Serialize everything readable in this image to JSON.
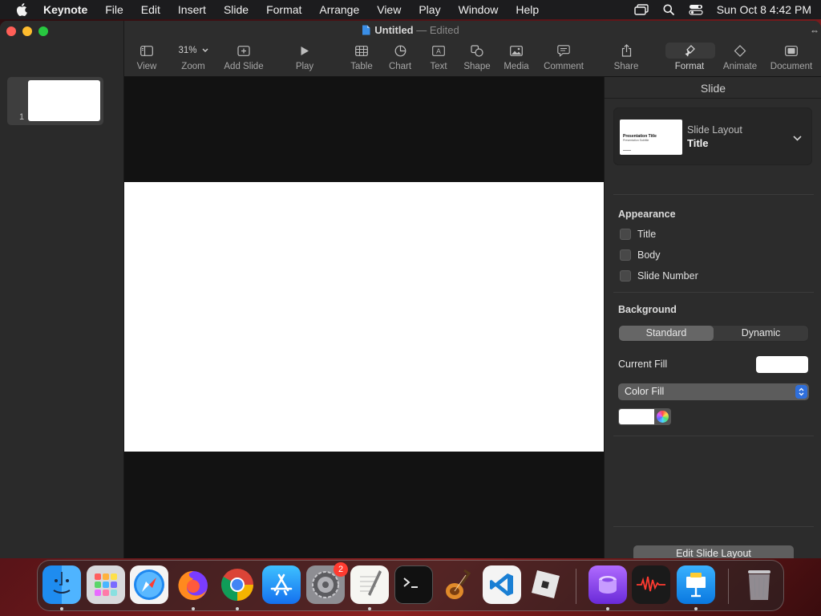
{
  "menubar": {
    "app_name": "Keynote",
    "items": [
      "File",
      "Edit",
      "Insert",
      "Slide",
      "Format",
      "Arrange",
      "View",
      "Play",
      "Window",
      "Help"
    ],
    "clock": "Sun Oct 8  4:42 PM"
  },
  "window": {
    "doc_name": "Untitled",
    "separator": "—",
    "doc_status": "Edited"
  },
  "toolbar": {
    "view": "View",
    "zoom_value": "31%",
    "zoom": "Zoom",
    "add_slide": "Add Slide",
    "play": "Play",
    "table": "Table",
    "chart": "Chart",
    "text": "Text",
    "shape": "Shape",
    "media": "Media",
    "comment": "Comment",
    "share": "Share",
    "format": "Format",
    "animate": "Animate",
    "document": "Document"
  },
  "navigator": {
    "slide_number": "1"
  },
  "inspector": {
    "title": "Slide",
    "layout_label": "Slide Layout",
    "layout_value": "Title",
    "layout_thumb_title": "Presentation Title",
    "layout_thumb_subtitle": "Presentation Subtitle",
    "appearance_heading": "Appearance",
    "appearance_options": [
      "Title",
      "Body",
      "Slide Number"
    ],
    "background_heading": "Background",
    "background_modes": [
      "Standard",
      "Dynamic"
    ],
    "current_fill_label": "Current Fill",
    "fill_type": "Color Fill",
    "edit_layout_button": "Edit Slide Layout"
  },
  "dock": {
    "settings_badge": "2"
  },
  "colors": {
    "accent": "#2f6fdb",
    "close": "#ff5f57",
    "minimize": "#febc2e",
    "maximize": "#28c840"
  }
}
